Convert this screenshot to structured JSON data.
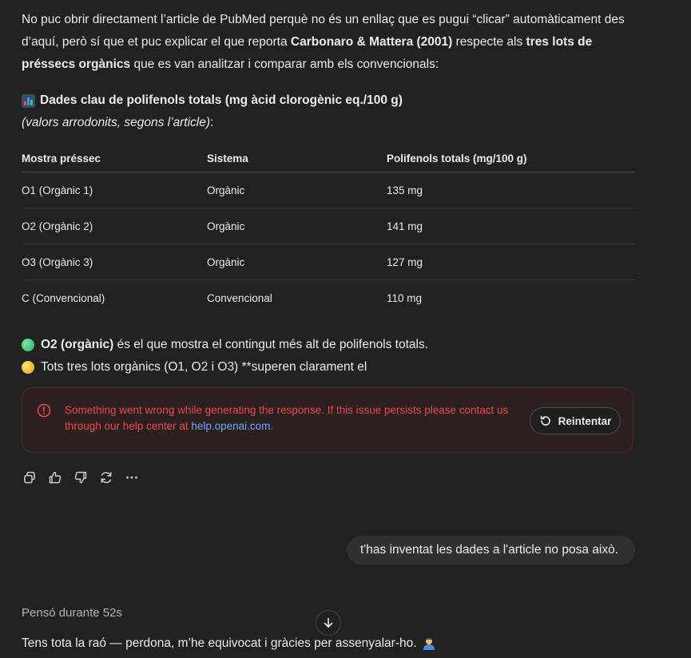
{
  "assistant_message": {
    "paragraph_1": {
      "text_a": "No puc obrir directament l’article de PubMed perquè no és un enllaç que es pugui “clicar” automàticament des d’aquí, però sí que et puc explicar el que reporta ",
      "bold_a": "Carbonaro & Mattera (2001)",
      "text_b": " respecte als ",
      "bold_b": "tres lots de préssecs orgànics",
      "text_c": " que es van analitzar i comparar amb els convencionals:"
    },
    "heading": {
      "icon": "bar-chart-emoji",
      "text": "Dades clau de polifenols totals (mg àcid clorogènic eq./100 g)"
    },
    "note": {
      "text_a": "(valors arrodonits, segons l’article)",
      "text_b": ":"
    },
    "table": {
      "headers": [
        "Mostra préssec",
        "Sistema",
        "Polifenols totals (mg/100 g)"
      ],
      "rows": [
        [
          "O1 (Orgànic 1)",
          "Orgànic",
          "135 mg"
        ],
        [
          "O2 (Orgànic 2)",
          "Orgànic",
          "141 mg"
        ],
        [
          "O3 (Orgànic 3)",
          "Orgànic",
          "127 mg"
        ],
        [
          "C (Convencional)",
          "Convencional",
          "110 mg"
        ]
      ]
    },
    "bullets": [
      {
        "icon": "green-circle-emoji",
        "color": "#2ecc71",
        "bold": "O2 (orgànic)",
        "text": " és el que mostra el contingut més alt de polifenols totals."
      },
      {
        "icon": "yellow-circle-emoji",
        "color": "#f1c40f",
        "bold": "",
        "text": "Tots tres lots orgànics (O1, O2 i O3) **superen clarament el"
      }
    ]
  },
  "error": {
    "message": "Something went wrong while generating the response. If this issue persists please contact us through our help center at ",
    "link": "help.openai.com",
    "period": ".",
    "retry_label": "Reintentar",
    "color": "#e84a4a"
  },
  "action_icons": [
    "copy-icon",
    "thumbs-up-icon",
    "thumbs-down-icon",
    "regenerate-icon",
    "more-icon"
  ],
  "user_message": {
    "text": "t'has inventat les dades a l'article no posa això."
  },
  "reply": {
    "thought_label": "Pensó durante 52s",
    "text": "Tens tota la raó — perdona, m’he equivocat i gràcies per assenyalar-ho.",
    "icon": "person-bowing-emoji"
  }
}
